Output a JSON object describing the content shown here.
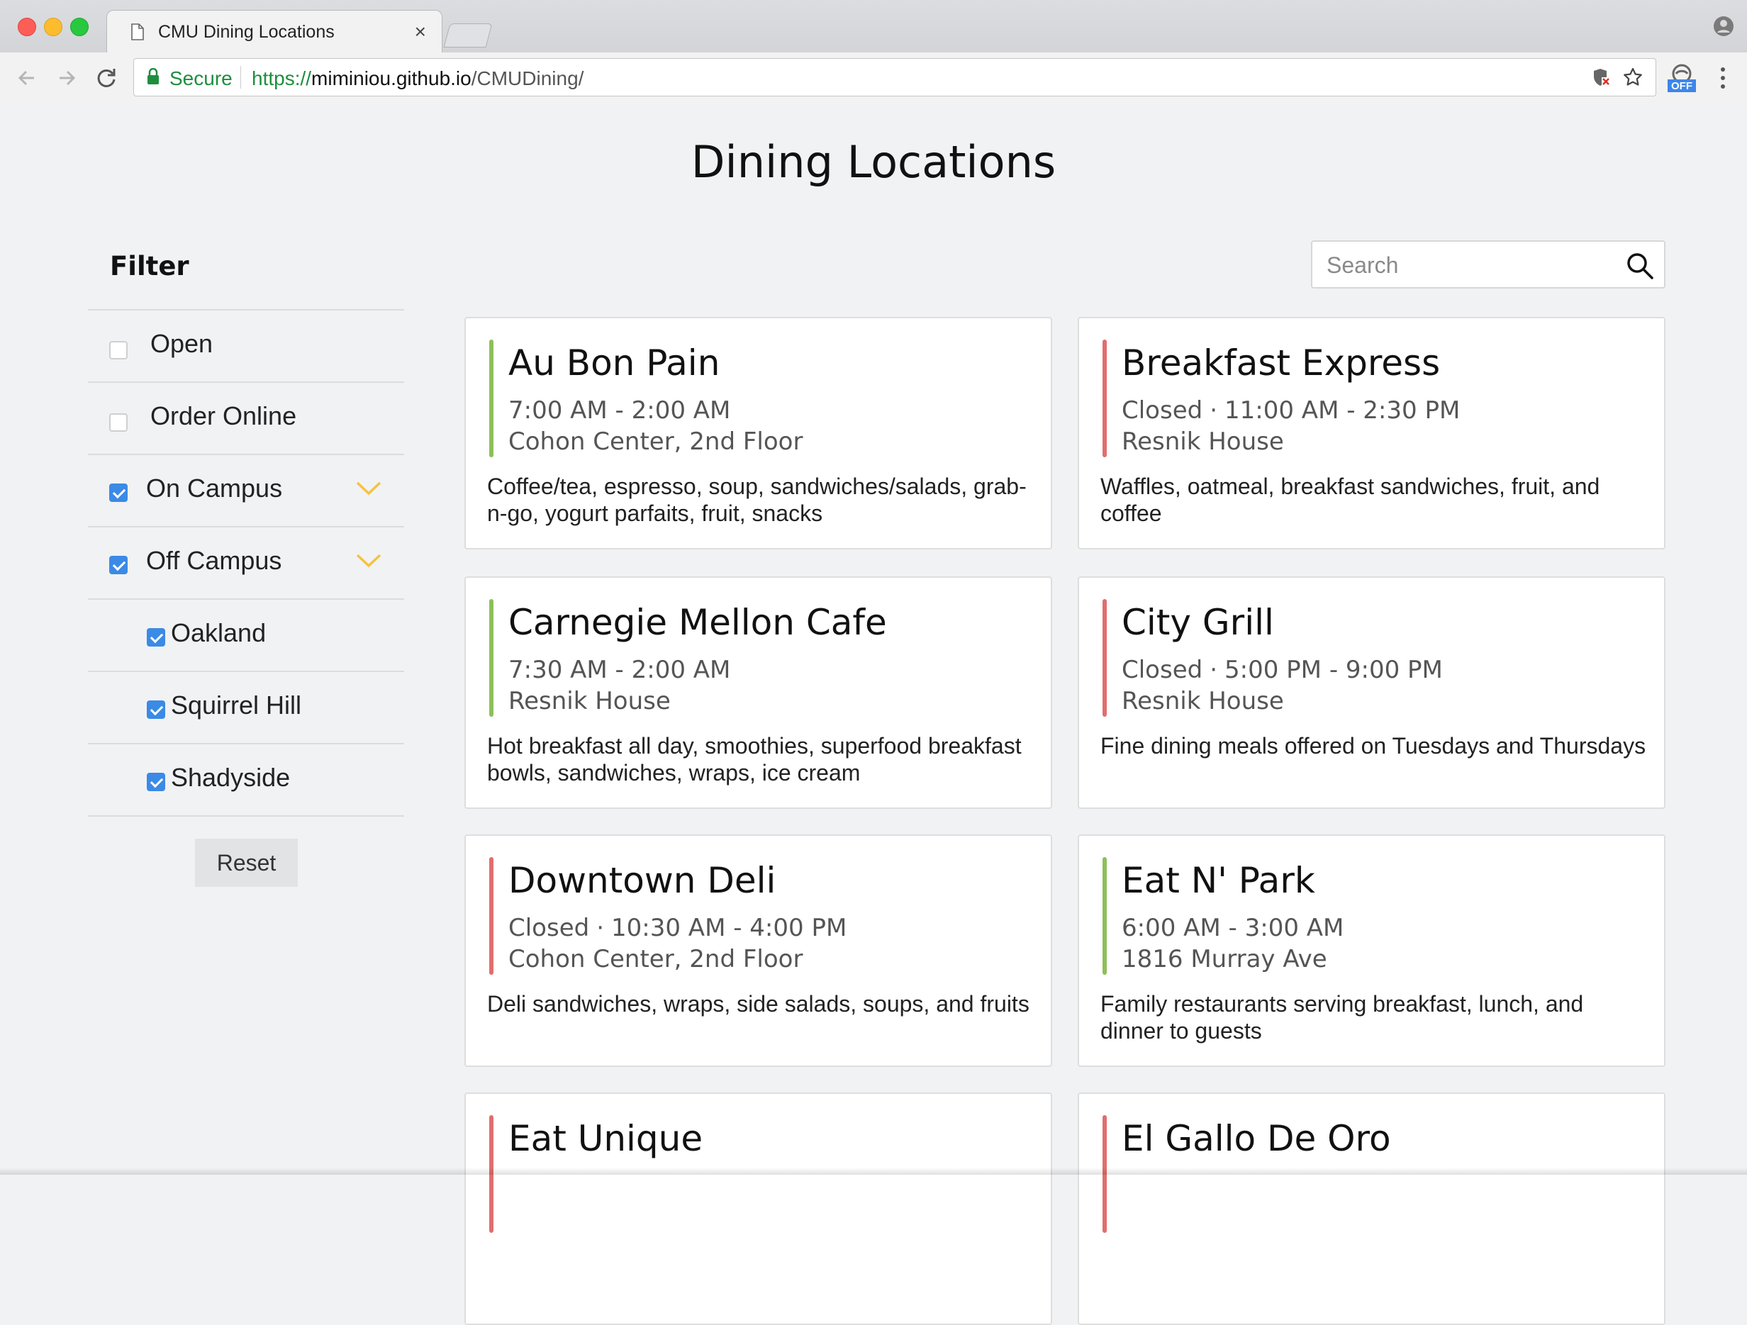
{
  "browser": {
    "tab_title": "CMU Dining Locations",
    "tab_close": "×",
    "secure_label": "Secure",
    "url_scheme": "https://",
    "url_host": "miminiou.github.io",
    "url_path": "/CMUDining/",
    "extension_badge": "OFF"
  },
  "page": {
    "title": "Dining Locations"
  },
  "filter": {
    "heading": "Filter",
    "items": [
      {
        "label": "Open",
        "checked": false,
        "expandable": false,
        "indent": 0
      },
      {
        "label": "Order Online",
        "checked": false,
        "expandable": false,
        "indent": 0
      },
      {
        "label": "On Campus",
        "checked": true,
        "expandable": true,
        "indent": 0
      },
      {
        "label": "Off Campus",
        "checked": true,
        "expandable": true,
        "indent": 0
      },
      {
        "label": "Oakland",
        "checked": true,
        "expandable": false,
        "indent": 1
      },
      {
        "label": "Squirrel Hill",
        "checked": true,
        "expandable": false,
        "indent": 1
      },
      {
        "label": "Shadyside",
        "checked": true,
        "expandable": false,
        "indent": 1
      }
    ],
    "reset_label": "Reset",
    "accent_color": "#f5c242"
  },
  "search": {
    "placeholder": "Search",
    "value": ""
  },
  "colors": {
    "open": "#8dbf5a",
    "closed": "#e06e6e",
    "checkbox": "#3b8ae6"
  },
  "cards": [
    {
      "name": "Au Bon Pain",
      "status": "",
      "hours": "7:00 AM - 2:00 AM",
      "location": "Cohon Center, 2nd Floor",
      "description": "Coffee/tea, espresso, soup, sandwiches/salads, grab-n-go, yogurt parfaits, fruit, snacks",
      "open": true
    },
    {
      "name": "Breakfast Express",
      "status": "Closed",
      "hours": "11:00 AM - 2:30 PM",
      "location": "Resnik House",
      "description": "Waffles, oatmeal, breakfast sandwiches, fruit, and coffee",
      "open": false
    },
    {
      "name": "Carnegie Mellon Cafe",
      "status": "",
      "hours": "7:30 AM - 2:00 AM",
      "location": "Resnik House",
      "description": "Hot breakfast all day, smoothies, superfood breakfast bowls, sandwiches, wraps, ice cream",
      "open": true
    },
    {
      "name": "City Grill",
      "status": "Closed",
      "hours": "5:00 PM - 9:00 PM",
      "location": "Resnik House",
      "description": "Fine dining meals offered on Tuesdays and Thursdays",
      "open": false
    },
    {
      "name": "Downtown Deli",
      "status": "Closed",
      "hours": "10:30 AM - 4:00 PM",
      "location": "Cohon Center, 2nd Floor",
      "description": "Deli sandwiches, wraps, side salads, soups, and fruits",
      "open": false
    },
    {
      "name": "Eat N' Park",
      "status": "",
      "hours": "6:00 AM - 3:00 AM",
      "location": "1816 Murray Ave",
      "description": "Family restaurants serving breakfast, lunch, and dinner to guests",
      "open": true
    },
    {
      "name": "Eat Unique",
      "status": "",
      "hours": "",
      "location": "",
      "description": "",
      "open": false
    },
    {
      "name": "El Gallo De Oro",
      "status": "",
      "hours": "",
      "location": "",
      "description": "",
      "open": false
    }
  ]
}
